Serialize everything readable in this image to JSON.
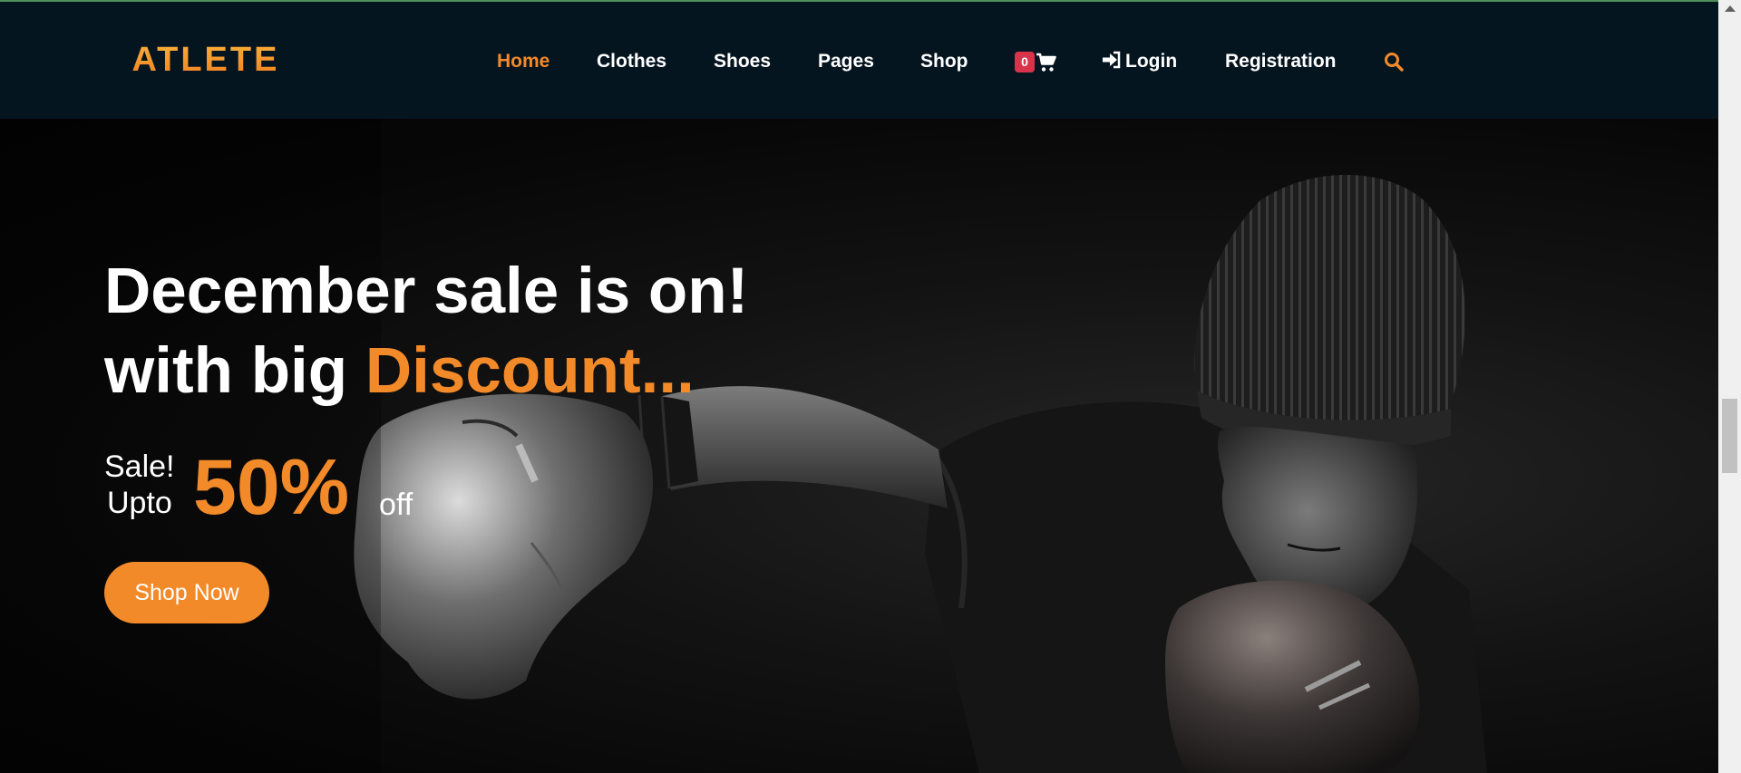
{
  "brand": {
    "logo_text": "ATLETE"
  },
  "nav": {
    "items": [
      {
        "label": "Home",
        "active": true
      },
      {
        "label": "Clothes"
      },
      {
        "label": "Shoes"
      },
      {
        "label": "Pages"
      },
      {
        "label": "Shop"
      }
    ],
    "cart": {
      "count": "0",
      "icon": "shopping-cart-icon"
    },
    "login": {
      "label": "Login",
      "icon": "sign-in-icon"
    },
    "registration": {
      "label": "Registration"
    },
    "search": {
      "icon": "search-icon"
    }
  },
  "hero": {
    "headline_line1": "December sale is on!",
    "headline_line2_prefix": "with big ",
    "headline_line2_accent": "Discount...",
    "sale_label": "Sale!",
    "upto_label": "Upto",
    "percent": "50%",
    "off_label": "off",
    "cta_label": "Shop Now"
  },
  "colors": {
    "accent": "#f38a29",
    "navbar_bg": "#051520",
    "badge": "#d9334b",
    "hero_bg": "#0c0c0c"
  }
}
